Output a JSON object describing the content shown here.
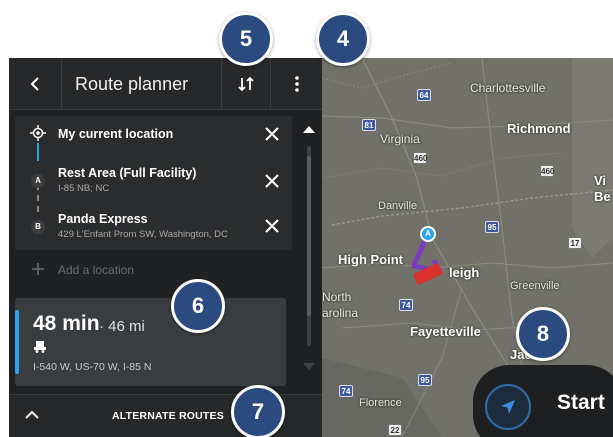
{
  "header": {
    "back_icon": "chevron-left-icon",
    "title": "Route planner",
    "sort_icon": "reorder-icon",
    "menu_icon": "more-vertical-icon"
  },
  "stops": [
    {
      "name": "My current location",
      "sub": "",
      "marker": "",
      "icon": "crosshair-location-icon"
    },
    {
      "name": "Rest Area (Full Facility)",
      "sub": "I-85 NB; NC",
      "marker": "A",
      "icon": ""
    },
    {
      "name": "Panda Express",
      "sub": "429 L'Enfant Prom SW, Washington, DC",
      "marker": "B",
      "icon": ""
    }
  ],
  "add_location": {
    "label": "Add a location"
  },
  "route": {
    "time": "48 min",
    "distance": "· 46 mi",
    "vehicle_icon": "truck-icon",
    "via": "I-540 W, US-70 W, I-85 N",
    "accent_color": "#2aa4ef"
  },
  "bottom": {
    "label": "ALTERNATE ROUTES",
    "icon": "chevron-up-icon"
  },
  "callouts": [
    "5",
    "4",
    "6",
    "7",
    "8"
  ],
  "start": {
    "label": "Start",
    "icon": "navigation-arrow-icon"
  },
  "map": {
    "labels": {
      "charlottesville": "Charlottesville",
      "virginia": "Virginia",
      "richmond": "Richmond",
      "danville": "Danville",
      "high_point": "High Point",
      "raleigh": "leigh",
      "greenville": "Greenville",
      "north": "North",
      "carolina": "arolina",
      "fayetteville": "Fayetteville",
      "florence": "Florence",
      "jacksonville": "Jac",
      "vi": "Vi",
      "be": "Be",
      "marker_a": "A"
    },
    "shields": [
      "81",
      "64",
      "460",
      "460",
      "95",
      "17",
      "74",
      "95",
      "74",
      "22"
    ]
  }
}
